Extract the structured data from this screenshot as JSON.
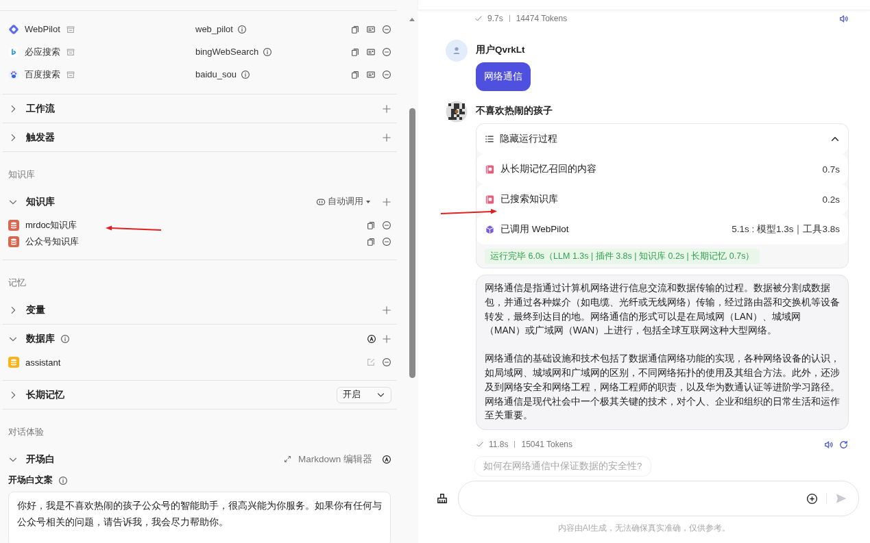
{
  "config": {
    "plugins": [
      {
        "name": "WebPilot",
        "api": "web_pilot",
        "kind": "webpilot"
      },
      {
        "name": "必应搜索",
        "api": "bingWebSearch",
        "kind": "bing"
      },
      {
        "name": "百度搜索",
        "api": "baidu_sou",
        "kind": "baidu"
      }
    ],
    "sections": [
      {
        "kind": "collapse",
        "title": "工作流",
        "expanded": false,
        "addable": true
      },
      {
        "kind": "collapse",
        "title": "触发器",
        "expanded": false,
        "addable": true
      },
      {
        "kind": "label",
        "title": "知识库"
      },
      {
        "kind": "collapse",
        "title": "知识库",
        "expanded": true,
        "addable": true,
        "mode": "自动调用",
        "items": [
          {
            "kind": "knowledge",
            "name": "mrdoc知识库"
          },
          {
            "kind": "knowledge",
            "name": "公众号知识库"
          }
        ]
      },
      {
        "kind": "label",
        "title": "记忆"
      },
      {
        "kind": "collapse",
        "title": "变量",
        "expanded": false,
        "addable": true
      },
      {
        "kind": "collapse",
        "title": "数据库",
        "expanded": true,
        "addable": true,
        "info": true,
        "auto": true,
        "items": [
          {
            "kind": "database",
            "name": "assistant"
          }
        ]
      },
      {
        "kind": "collapse",
        "title": "长期记忆",
        "expanded": false,
        "select": "开启"
      },
      {
        "kind": "label",
        "title": "对话体验"
      },
      {
        "kind": "collapse",
        "title": "开场白",
        "expanded": true,
        "editor": "Markdown 编辑器",
        "auto": true,
        "field": {
          "label": "开场白文案",
          "value": "你好，我是不喜欢热闹的孩子公众号的智能助手，很高兴能为你服务。如果你有任何与公众号相关的问题，请告诉我，我会尽力帮助你。"
        }
      }
    ]
  },
  "chat": {
    "previous_meta": {
      "time": "9.7s",
      "tokens": "14474 Tokens"
    },
    "user": {
      "name": "用户QvrkLt",
      "message": "网络通信"
    },
    "bot": {
      "name": "不喜欢热闹的孩子",
      "process": {
        "title": "隐藏运行过程",
        "expanded": true,
        "steps": [
          {
            "kind": "memory",
            "label": "从长期记忆召回的内容",
            "time": "0.7s"
          },
          {
            "kind": "knowledge",
            "label": "已搜索知识库",
            "time": "0.2s"
          },
          {
            "kind": "plugin",
            "label": "已调用 WebPilot",
            "time": "5.1s : 模型1.3s｜工具3.8s"
          }
        ],
        "summary": "运行完毕 6.0s（LLM 1.3s | 插件 3.8s | 知识库 0.2s | 长期记忆 0.7s）"
      },
      "paragraphs": [
        "网络通信是指通过计算机网络进行信息交流和数据传输的过程。数据被分割成数据包，并通过各种媒介（如电缆、光纤或无线网络）传输，经过路由器和交换机等设备转发，最终到达目的地。网络通信的形式可以是在局域网（LAN）、城域网（MAN）或广域网（WAN）上进行，包括全球互联网这种大型网络。",
        "网络通信的基础设施和技术包括了数据通信网络功能的实现，各种网络设备的认识，如局域网、城域网和广域网的区别，不同网络拓扑的使用及其组合方法。此外，还涉及到网络安全和网络工程，网络工程师的职责，以及华为数通认证等进阶学习路径。网络通信是现代社会中一个极其关键的技术，对个人、企业和组织的日常生活和运作至关重要。"
      ],
      "meta": {
        "time": "11.8s",
        "tokens": "15041 Tokens",
        "regenerate": true
      }
    },
    "suggestion": "如何在网络通信中保证数据的安全性?",
    "disclaimer": "内容由AI生成，无法确保真实准确，仅供参考。"
  }
}
